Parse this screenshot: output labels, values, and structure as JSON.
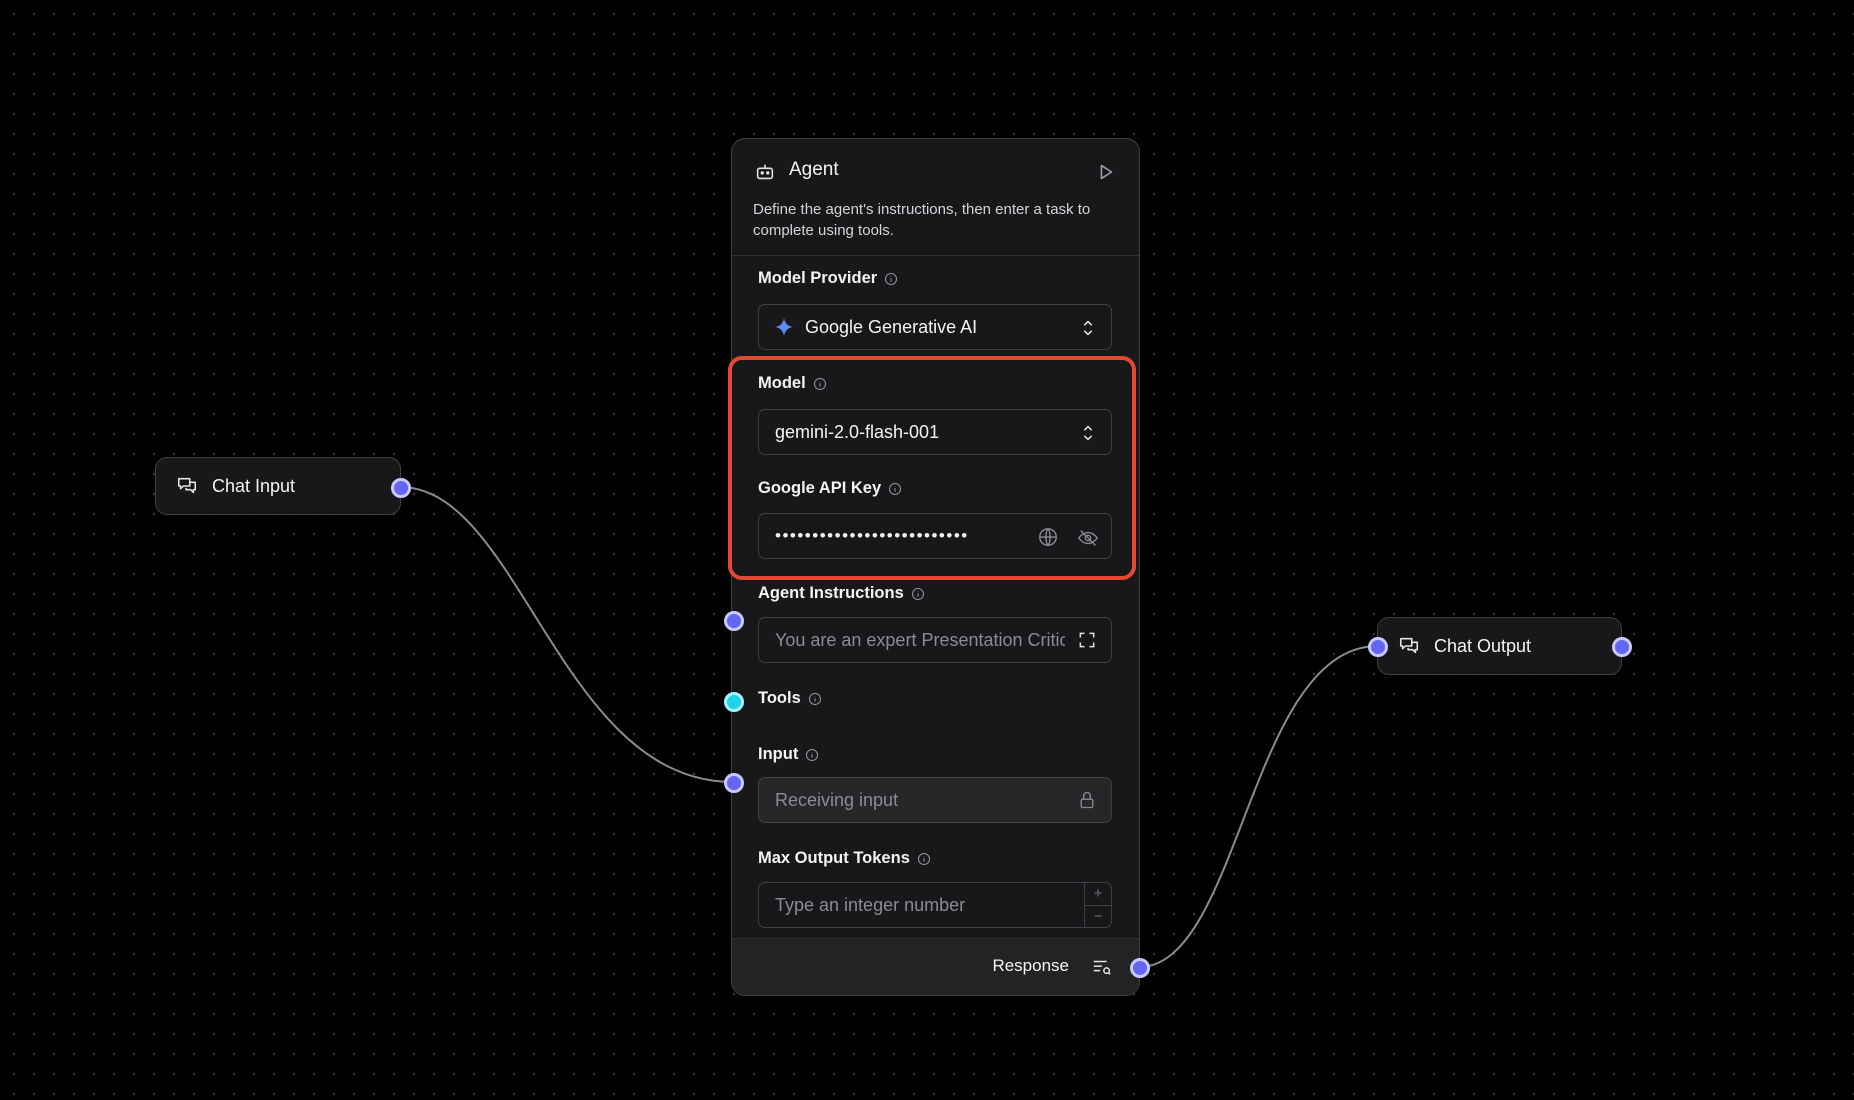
{
  "nodes": {
    "chat_input": {
      "label": "Chat Input"
    },
    "chat_output": {
      "label": "Chat Output"
    }
  },
  "agent": {
    "title": "Agent",
    "description": "Define the agent's instructions, then enter a task to complete using tools.",
    "model_provider": {
      "label": "Model Provider",
      "value": "Google Generative AI"
    },
    "model": {
      "label": "Model",
      "value": "gemini-2.0-flash-001"
    },
    "api_key": {
      "label": "Google API Key",
      "value": "••••••••••••••••••••••••••"
    },
    "instructions": {
      "label": "Agent Instructions",
      "value": "You are an expert Presentation Critic"
    },
    "tools": {
      "label": "Tools"
    },
    "input": {
      "label": "Input",
      "placeholder": "Receiving input"
    },
    "max_tokens": {
      "label": "Max Output Tokens",
      "placeholder": "Type an integer number",
      "plus": "+",
      "minus": "−"
    },
    "output": {
      "label": "Response"
    }
  },
  "icons": {
    "chat": "chat-bubbles-icon",
    "bot": "bot-icon",
    "play": "play-icon",
    "info": "info-icon",
    "sparkle": "gemini-sparkle-icon",
    "chevrons": "chevrons-up-down-icon",
    "globe": "globe-icon",
    "eye_off": "eye-off-icon",
    "expand": "expand-icon",
    "lock": "lock-icon",
    "inspect": "inspect-output-icon"
  },
  "colors": {
    "handle": "#6366f1",
    "tool_handle": "#22d3ee",
    "highlight": "#e44a32",
    "sparkle": "#5b8def"
  }
}
